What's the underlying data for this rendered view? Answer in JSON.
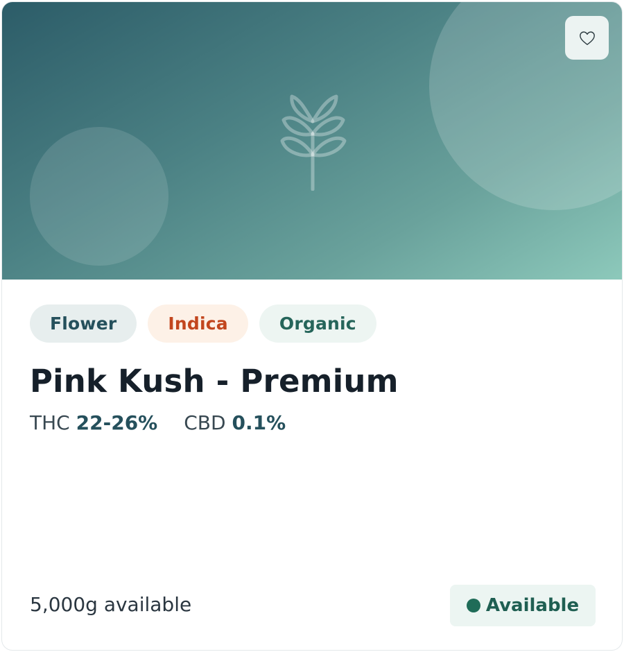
{
  "product": {
    "tags": [
      {
        "label": "Flower",
        "color": "#25505c"
      },
      {
        "label": "Indica",
        "color": "#c2461e"
      },
      {
        "label": "Organic",
        "color": "#25655a"
      }
    ],
    "name": "Pink Kush - Premium",
    "thc": {
      "label": "THC",
      "value": "22-26%"
    },
    "cbd": {
      "label": "CBD",
      "value": "0.1%"
    },
    "quantity": "5,000g available",
    "status": {
      "label": "Available",
      "color": "#1f6c58"
    },
    "image_icon": "plant-icon",
    "favorite_icon": "heart-outline-icon"
  }
}
